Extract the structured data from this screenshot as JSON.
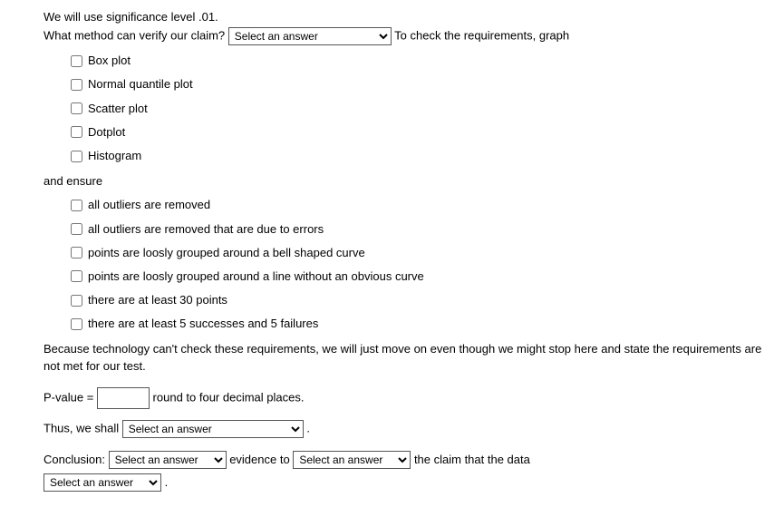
{
  "intro": {
    "line1": "We will use significance level .01.",
    "line2_a": "What method can verify our claim?",
    "line2_b": "To check the requirements, graph"
  },
  "select_placeholder": "Select an answer",
  "graphs": [
    "Box plot",
    "Normal quantile plot",
    "Scatter plot",
    "Dotplot",
    "Histogram"
  ],
  "ensure_label": "and ensure",
  "ensure_items": [
    "all outliers are removed",
    "all outliers are removed that are due to errors",
    "points are loosly grouped around a bell shaped curve",
    "points are loosly grouped around a line without an obvious curve",
    "there are at least 30 points",
    "there are at least 5 successes and 5 failures"
  ],
  "tech_note": "Because technology can't check these requirements, we will just move on even though we might stop here and state the requirements are not met for our test.",
  "pvalue_label": "P-value =",
  "pvalue_after": "round to four decimal places.",
  "thus_label": "Thus, we shall",
  "period": ".",
  "conclusion_label": "Conclusion:",
  "evidence_label": "evidence to",
  "claim_label": "the claim that the data"
}
